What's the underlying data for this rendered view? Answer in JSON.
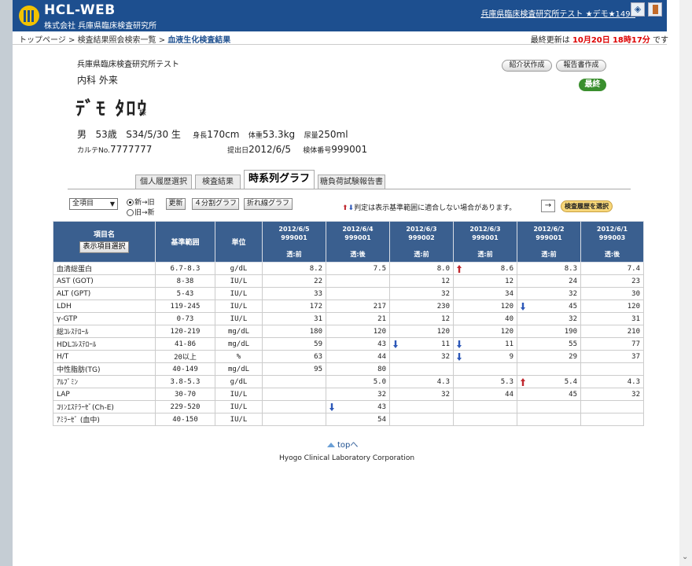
{
  "header": {
    "logo_text": "HCL-WEB",
    "logo_sub": "株式会社 兵庫県臨床検査研究所",
    "user": "兵庫県臨床検査研究所テスト ★デモ★1499"
  },
  "breadcrumb": {
    "items": [
      "トップページ",
      "検査結果照会検索一覧",
      "血液生化検査結果"
    ],
    "separator": " > "
  },
  "last_update": {
    "prefix": "最終更新は",
    "date": "10月20日",
    "time": "18時17分",
    "suffix": "です"
  },
  "patient": {
    "institution": "兵庫県臨床検査研究所テスト",
    "dept": "内科 外来",
    "name": "ﾃﾞﾓ ﾀﾛｳ",
    "sama": "様",
    "sex": "男",
    "age": "53歳",
    "birth": "S34/5/30 生",
    "height_label": "身長",
    "height": "170cm",
    "weight_label": "体重",
    "weight": "53.3kg",
    "urine_label": "尿量",
    "urine": "250ml",
    "karte_label": "カルテNo.",
    "karte": "7777777",
    "submit_label": "提出日",
    "submit": "2012/6/5",
    "specimen_label": "検体番号",
    "specimen": "999001"
  },
  "actions": {
    "intro_form": "紹介状作成",
    "report_form": "報告書作成",
    "final_badge": "最終"
  },
  "tabs": [
    "個人履歴選択",
    "検査結果",
    "時系列グラフ",
    "糖負荷試験報告書"
  ],
  "controls": {
    "select_value": "全項目",
    "radio_new_old": "新→旧",
    "radio_old_new": "旧→新",
    "update": "更新",
    "split_graph": "４分割グラフ",
    "line_graph": "折れ線グラフ",
    "note": "判定は表示基準範囲に適合しない場合があります。",
    "arrow": "→",
    "history_select": "検査履歴を選択"
  },
  "table": {
    "col_item": "項目名",
    "col_item_button": "表示項目選択",
    "col_ref": "基準範囲",
    "col_unit": "単位",
    "dates": [
      {
        "date": "2012/6/5",
        "id": "999001",
        "sub": "透:前"
      },
      {
        "date": "2012/6/4",
        "id": "999001",
        "sub": "透:後"
      },
      {
        "date": "2012/6/3",
        "id": "999002",
        "sub": "透:前"
      },
      {
        "date": "2012/6/3",
        "id": "999001",
        "sub": "透:前"
      },
      {
        "date": "2012/6/2",
        "id": "999001",
        "sub": "透:前"
      },
      {
        "date": "2012/6/1",
        "id": "999003",
        "sub": "透:後"
      }
    ],
    "rows": [
      {
        "name": "血清総蛋白",
        "ref": "6.7-8.3",
        "unit": "g/dL",
        "values": [
          "8.2",
          "7.5",
          "8.0",
          "8.6",
          "8.3",
          "7.4"
        ],
        "flags": [
          "",
          "",
          "",
          "up",
          "",
          ""
        ]
      },
      {
        "name": "AST (GOT)",
        "ref": "8-38",
        "unit": "IU/L",
        "values": [
          "22",
          "",
          "12",
          "12",
          "24",
          "23"
        ],
        "flags": [
          "",
          "",
          "",
          "",
          "",
          ""
        ]
      },
      {
        "name": "ALT (GPT)",
        "ref": "5-43",
        "unit": "IU/L",
        "values": [
          "33",
          "",
          "32",
          "34",
          "32",
          "30"
        ],
        "flags": [
          "",
          "",
          "",
          "",
          "",
          ""
        ]
      },
      {
        "name": "LDH",
        "ref": "119-245",
        "unit": "IU/L",
        "values": [
          "172",
          "217",
          "230",
          "120",
          "45",
          "120"
        ],
        "flags": [
          "",
          "",
          "",
          "",
          "dn",
          ""
        ]
      },
      {
        "name": "γ-GTP",
        "ref": "0-73",
        "unit": "IU/L",
        "values": [
          "31",
          "21",
          "12",
          "40",
          "32",
          "31"
        ],
        "flags": [
          "",
          "",
          "",
          "",
          "",
          ""
        ]
      },
      {
        "name": "総ｺﾚｽﾃﾛｰﾙ",
        "ref": "120-219",
        "unit": "mg/dL",
        "values": [
          "180",
          "120",
          "120",
          "120",
          "190",
          "210"
        ],
        "flags": [
          "",
          "",
          "",
          "",
          "",
          ""
        ]
      },
      {
        "name": "HDLｺﾚｽﾃﾛｰﾙ",
        "ref": "41-86",
        "unit": "mg/dL",
        "values": [
          "59",
          "43",
          "11",
          "11",
          "55",
          "77"
        ],
        "flags": [
          "",
          "",
          "dn",
          "dn",
          "",
          ""
        ]
      },
      {
        "name": "H/T",
        "ref": "20以上",
        "unit": "%",
        "values": [
          "63",
          "44",
          "32",
          "9",
          "29",
          "37"
        ],
        "flags": [
          "",
          "",
          "",
          "dn",
          "",
          ""
        ]
      },
      {
        "name": "中性脂肪(TG)",
        "ref": "40-149",
        "unit": "mg/dL",
        "values": [
          "95",
          "80",
          "",
          "",
          "",
          ""
        ],
        "flags": [
          "",
          "",
          "",
          "",
          "",
          ""
        ]
      },
      {
        "name": "ｱﾙﾌﾞﾐﾝ",
        "ref": "3.8-5.3",
        "unit": "g/dL",
        "values": [
          "",
          "5.0",
          "4.3",
          "5.3",
          "5.4",
          "4.3"
        ],
        "flags": [
          "",
          "",
          "",
          "",
          "up",
          ""
        ]
      },
      {
        "name": "LAP",
        "ref": "30-70",
        "unit": "IU/L",
        "values": [
          "",
          "32",
          "32",
          "44",
          "45",
          "32"
        ],
        "flags": [
          "",
          "",
          "",
          "",
          "",
          ""
        ]
      },
      {
        "name": "ｺﾘﾝｴｽﾃﾗｰｾﾞ(Ch-E)",
        "ref": "229-520",
        "unit": "IU/L",
        "values": [
          "",
          "43",
          "",
          "",
          "",
          ""
        ],
        "flags": [
          "",
          "dn",
          "",
          "",
          "",
          ""
        ]
      },
      {
        "name": "ｱﾐﾗｰｾﾞ (血中)",
        "ref": "40-150",
        "unit": "IU/L",
        "values": [
          "",
          "54",
          "",
          "",
          "",
          ""
        ],
        "flags": [
          "",
          "",
          "",
          "",
          "",
          ""
        ]
      }
    ]
  },
  "footer": {
    "top_link": "topへ",
    "company": "Hyogo Clinical Laboratory Corporation"
  }
}
